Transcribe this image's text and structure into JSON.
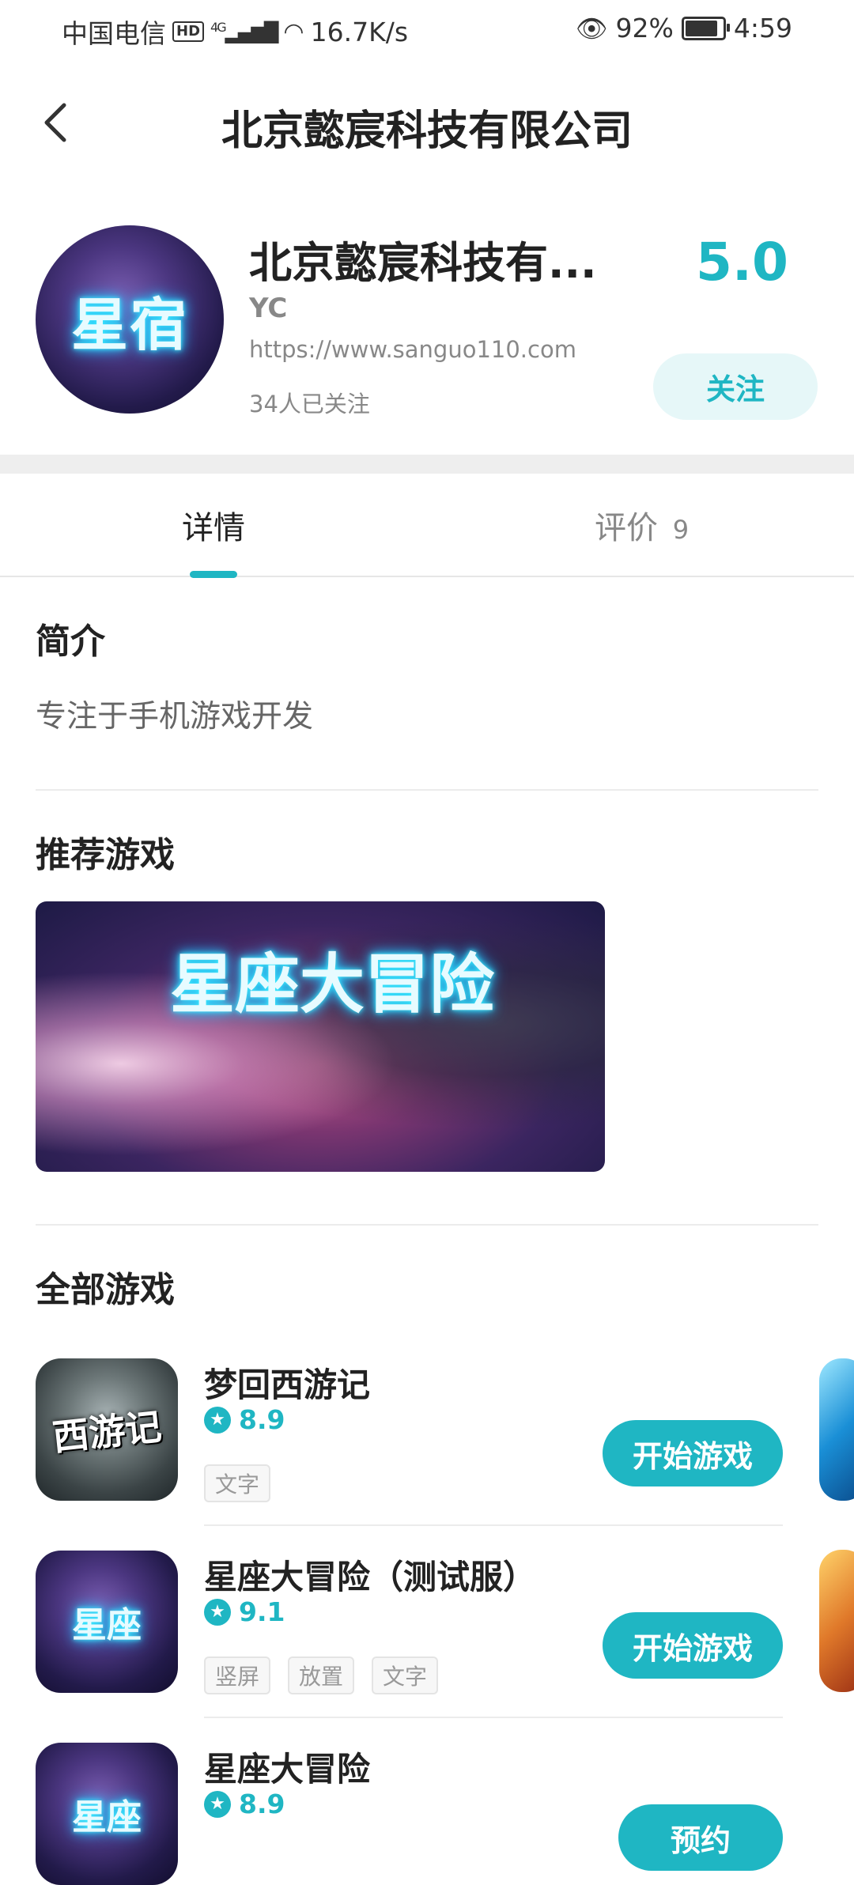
{
  "status_bar": {
    "carrier": "中国电信",
    "hd": "HD",
    "network": "4G",
    "speed": "16.7K/s",
    "battery": "92%",
    "battery_level": 0.92,
    "time": "4:59"
  },
  "header": {
    "title": "北京懿宸科技有限公司"
  },
  "company": {
    "logo_text": "星宿",
    "name": "北京懿宸科技有...",
    "abbr": "YC",
    "url": "https://www.sanguo110.com",
    "followers": "34人已关注",
    "rating": "5.0",
    "follow_label": "关注"
  },
  "tabs": [
    {
      "label": "详情"
    },
    {
      "label": "评价",
      "count": "9"
    }
  ],
  "intro": {
    "title": "简介",
    "text": "专注于手机游戏开发"
  },
  "recommended": {
    "title": "推荐游戏",
    "banner_text": "星座大冒险"
  },
  "all_games": {
    "title": "全部游戏",
    "items": [
      {
        "name": "梦回西游记",
        "icon_text": "西游记",
        "rating": "8.9",
        "tags": [
          "文字"
        ],
        "action": "开始游戏"
      },
      {
        "name": "星座大冒险（测试服）",
        "icon_text": "星座",
        "rating": "9.1",
        "tags": [
          "竖屏",
          "放置",
          "文字"
        ],
        "action": "开始游戏"
      },
      {
        "name": "星座大冒险",
        "icon_text": "星座",
        "rating": "8.9",
        "tags": [],
        "action": "预约"
      }
    ]
  },
  "colors": {
    "accent": "#1fb6c3",
    "accent_light": "#e6f7f8"
  }
}
